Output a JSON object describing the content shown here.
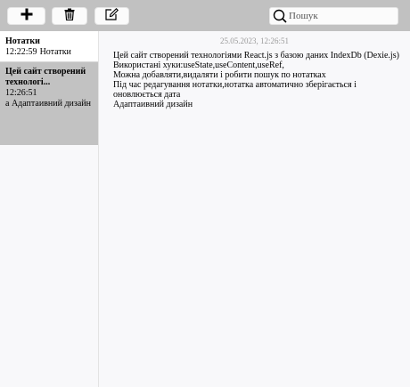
{
  "toolbar": {
    "add_icon": "plus-icon",
    "delete_icon": "trash-icon",
    "edit_icon": "edit-icon",
    "search_placeholder": "Пошук",
    "search_icon": "search-icon"
  },
  "sidebar": {
    "items": [
      {
        "title": "Нотатки",
        "time": "12:22:59",
        "preview": "Нотатки"
      },
      {
        "title": "Цей сайт створений\nтехнологі...",
        "time": "12:26:51",
        "preview": "а Адаптаивний дизайн"
      }
    ]
  },
  "content": {
    "date": "25.05.2023, 12:26:51",
    "lines": [
      "Цей сайт створений технологіями React.js з базою даних IndexDb (Dexie.js)",
      "Використані хуки:useState,useContent,useRef,",
      "Можна добавляти,видаляти і робити пошук по нотатках",
      "Під час редагування нотатки,нотатка автоматично зберігається і оновлюється дата",
      "Адаптаивний дизайн"
    ]
  },
  "colors": {
    "toolbar_bg": "#c1c1c1",
    "selected_item_bg": "#c2c2c2",
    "content_bg": "#f8f8fa",
    "date_text": "#9a9a9a"
  }
}
